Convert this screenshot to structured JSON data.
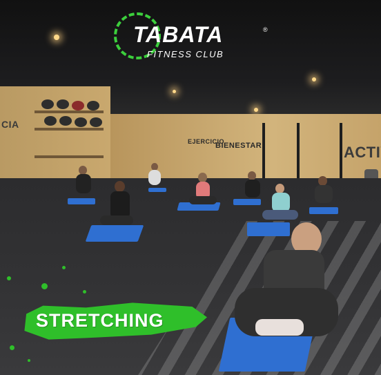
{
  "logo": {
    "title": "TABATA",
    "registered": "®",
    "subtitle": "FITNESS CLUB",
    "accent_color": "#3ccf3c"
  },
  "wall_signs": {
    "left": "CIA",
    "ejercicio": "EJERCICIO",
    "bienestar": "BIENESTAR",
    "right": "ACTIV"
  },
  "badge": {
    "label": "STRETCHING",
    "color": "#2fbf2a"
  },
  "mat_color": "#2f6fd1"
}
